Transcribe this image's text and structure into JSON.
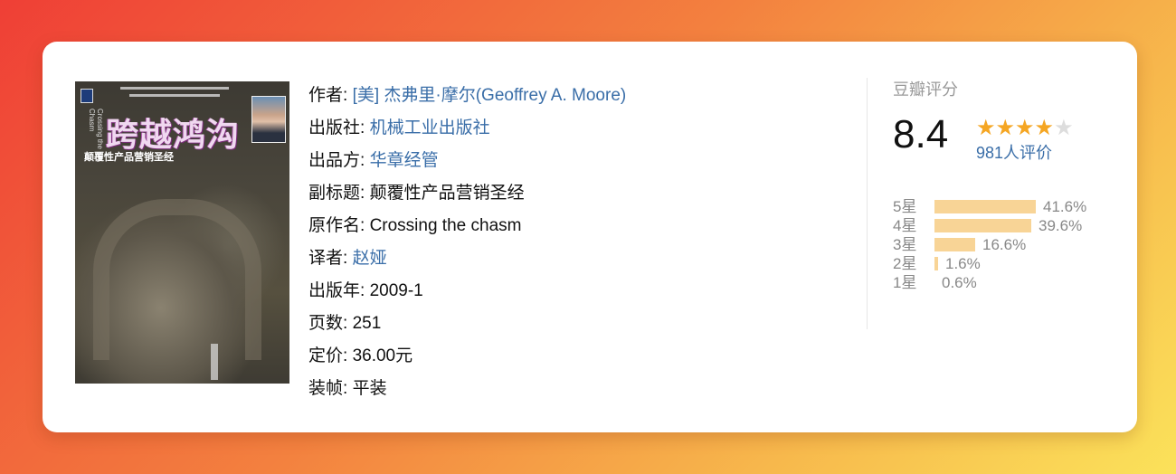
{
  "cover": {
    "title_cn": "跨越鸿沟",
    "title_en": "Crossing the Chasm",
    "subtitle": "颠覆性产品营销圣经"
  },
  "info": [
    {
      "label": "作者: ",
      "value": "[美] 杰弗里·摩尔(Geoffrey A. Moore)",
      "link": true
    },
    {
      "label": "出版社: ",
      "value": "机械工业出版社",
      "link": true
    },
    {
      "label": "出品方: ",
      "value": "华章经管",
      "link": true
    },
    {
      "label": "副标题: ",
      "value": "颠覆性产品营销圣经",
      "link": false
    },
    {
      "label": "原作名: ",
      "value": "Crossing the chasm",
      "link": false
    },
    {
      "label": "译者: ",
      "value": "赵娅",
      "link": true
    },
    {
      "label": "出版年: ",
      "value": "2009-1",
      "link": false
    },
    {
      "label": "页数: ",
      "value": "251",
      "link": false
    },
    {
      "label": "定价: ",
      "value": "36.00元",
      "link": false
    },
    {
      "label": "装帧: ",
      "value": "平装",
      "link": false
    }
  ],
  "rating": {
    "title": "豆瓣评分",
    "score": "8.4",
    "stars_filled": 4,
    "stars_total": 5,
    "count_label": "981人评价",
    "distribution": [
      {
        "label": "5星",
        "percent": 41.6,
        "text": "41.6%"
      },
      {
        "label": "4星",
        "percent": 39.6,
        "text": "39.6%"
      },
      {
        "label": "3星",
        "percent": 16.6,
        "text": "16.6%"
      },
      {
        "label": "2星",
        "percent": 1.6,
        "text": "1.6%"
      },
      {
        "label": "1星",
        "percent": 0.6,
        "text": "0.6%"
      }
    ]
  },
  "colors": {
    "link": "#3a6ea8",
    "star": "#f5a623",
    "bar": "#f8d496"
  }
}
